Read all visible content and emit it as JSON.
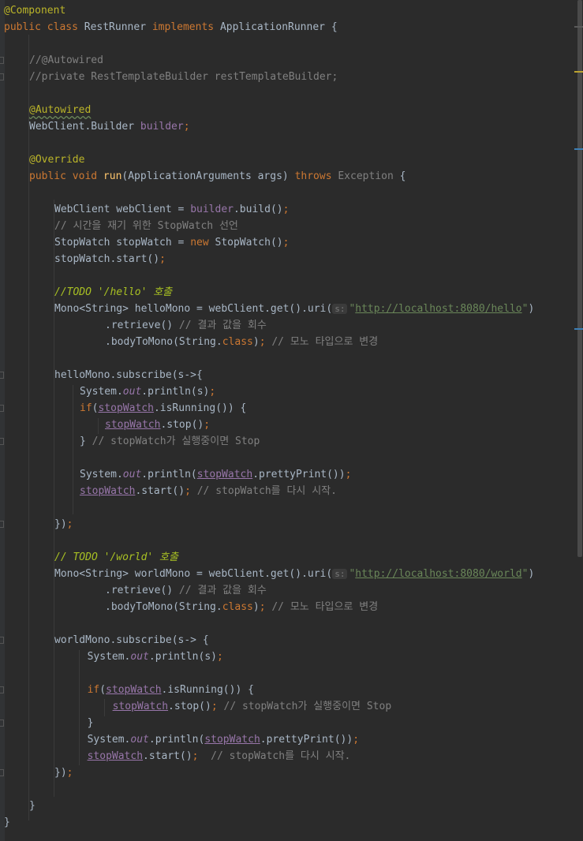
{
  "editor": {
    "language": "java",
    "colors": {
      "background": "#2b2b2b",
      "keyword": "#cc7832",
      "annotation": "#bbb529",
      "comment": "#808080",
      "todo": "#a8c023",
      "string": "#6a8759",
      "field": "#9876aa",
      "function": "#ffc66d",
      "text": "#a9b7c6"
    },
    "lines": [
      {
        "indent": 0,
        "tokens": [
          {
            "t": "@Component",
            "c": "ann"
          }
        ]
      },
      {
        "indent": 0,
        "tokens": [
          {
            "t": "public class ",
            "c": "kw"
          },
          {
            "t": "RestRunner ",
            "c": "plain"
          },
          {
            "t": "implements ",
            "c": "kw"
          },
          {
            "t": "ApplicationRunner {",
            "c": "plain"
          }
        ]
      },
      {
        "indent": 0,
        "tokens": []
      },
      {
        "indent": 1,
        "tokens": [
          {
            "t": "//@Autowired",
            "c": "cmt"
          }
        ]
      },
      {
        "indent": 1,
        "tokens": [
          {
            "t": "//private RestTemplateBuilder restTemplateBuilder;",
            "c": "cmt"
          }
        ]
      },
      {
        "indent": 0,
        "tokens": []
      },
      {
        "indent": 1,
        "tokens": [
          {
            "t": "@Autowired",
            "c": "anns"
          }
        ]
      },
      {
        "indent": 1,
        "tokens": [
          {
            "t": "WebClient.Builder ",
            "c": "plain"
          },
          {
            "t": "builder",
            "c": "fld"
          },
          {
            "t": ";",
            "c": "kw"
          }
        ]
      },
      {
        "indent": 0,
        "tokens": []
      },
      {
        "indent": 1,
        "tokens": [
          {
            "t": "@Override",
            "c": "ann"
          }
        ]
      },
      {
        "indent": 1,
        "tokens": [
          {
            "t": "public void ",
            "c": "kw"
          },
          {
            "t": "run",
            "c": "fn"
          },
          {
            "t": "(ApplicationArguments args) ",
            "c": "plain"
          },
          {
            "t": "throws ",
            "c": "kw"
          },
          {
            "t": "Exception",
            "c": "grey"
          },
          {
            "t": " {",
            "c": "plain"
          }
        ]
      },
      {
        "indent": 0,
        "tokens": []
      },
      {
        "indent": 2,
        "tokens": [
          {
            "t": "WebClient webClient = ",
            "c": "plain"
          },
          {
            "t": "builder",
            "c": "fld"
          },
          {
            "t": ".build()",
            "c": "plain"
          },
          {
            "t": ";",
            "c": "kw"
          }
        ]
      },
      {
        "indent": 2,
        "tokens": [
          {
            "t": "// 시간을 재기 위한 StopWatch 선언",
            "c": "cmt"
          }
        ]
      },
      {
        "indent": 2,
        "tokens": [
          {
            "t": "StopWatch stopWatch = ",
            "c": "plain"
          },
          {
            "t": "new ",
            "c": "kw"
          },
          {
            "t": "StopWatch()",
            "c": "plain"
          },
          {
            "t": ";",
            "c": "kw"
          }
        ]
      },
      {
        "indent": 2,
        "tokens": [
          {
            "t": "stopWatch.start()",
            "c": "plain"
          },
          {
            "t": ";",
            "c": "kw"
          }
        ]
      },
      {
        "indent": 0,
        "tokens": []
      },
      {
        "indent": 2,
        "tokens": [
          {
            "t": "//TODO '/hello' 호출",
            "c": "todo"
          }
        ]
      },
      {
        "indent": 2,
        "tokens": [
          {
            "t": "Mono<String> helloMono = webClient.get().uri(",
            "c": "plain"
          },
          {
            "t": "s:",
            "c": "hint"
          },
          {
            "t": "\"",
            "c": "str"
          },
          {
            "t": "http://localhost:8080/hello",
            "c": "url"
          },
          {
            "t": "\"",
            "c": "str"
          },
          {
            "t": ")",
            "c": "plain"
          }
        ]
      },
      {
        "indent": 4,
        "tokens": [
          {
            "t": ".retrieve() ",
            "c": "plain"
          },
          {
            "t": "// 결과 값을 회수",
            "c": "cmt"
          }
        ]
      },
      {
        "indent": 4,
        "tokens": [
          {
            "t": ".bodyToMono(String.",
            "c": "plain"
          },
          {
            "t": "class",
            "c": "kw"
          },
          {
            "t": ")",
            "c": "plain"
          },
          {
            "t": "; ",
            "c": "kw"
          },
          {
            "t": "// 모노 타입으로 변경",
            "c": "cmt"
          }
        ]
      },
      {
        "indent": 0,
        "tokens": []
      },
      {
        "indent": 2,
        "tokens": [
          {
            "t": "helloMono.subscribe(s->{",
            "c": "plain"
          }
        ]
      },
      {
        "indent": 3,
        "tokens": [
          {
            "t": "System.",
            "c": "plain"
          },
          {
            "t": "out",
            "c": "ifld"
          },
          {
            "t": ".println(s)",
            "c": "plain"
          },
          {
            "t": ";",
            "c": "kw"
          }
        ]
      },
      {
        "indent": 3,
        "tokens": [
          {
            "t": "if",
            "c": "kw"
          },
          {
            "t": "(",
            "c": "plain"
          },
          {
            "t": "stopWatch",
            "c": "var"
          },
          {
            "t": ".isRunning()) {",
            "c": "plain"
          }
        ]
      },
      {
        "indent": 4,
        "tokens": [
          {
            "t": "stopWatch",
            "c": "var"
          },
          {
            "t": ".stop()",
            "c": "plain"
          },
          {
            "t": ";",
            "c": "kw"
          }
        ]
      },
      {
        "indent": 3,
        "tokens": [
          {
            "t": "} ",
            "c": "plain"
          },
          {
            "t": "// stopWatch가 실행중이면 Stop",
            "c": "cmt"
          }
        ]
      },
      {
        "indent": 0,
        "tokens": []
      },
      {
        "indent": 3,
        "tokens": [
          {
            "t": "System.",
            "c": "plain"
          },
          {
            "t": "out",
            "c": "ifld"
          },
          {
            "t": ".println(",
            "c": "plain"
          },
          {
            "t": "stopWatch",
            "c": "var"
          },
          {
            "t": ".prettyPrint())",
            "c": "plain"
          },
          {
            "t": ";",
            "c": "kw"
          }
        ]
      },
      {
        "indent": 3,
        "tokens": [
          {
            "t": "stopWatch",
            "c": "var"
          },
          {
            "t": ".start()",
            "c": "plain"
          },
          {
            "t": "; ",
            "c": "kw"
          },
          {
            "t": "// stopWatch를 다시 시작.",
            "c": "cmt"
          }
        ]
      },
      {
        "indent": 0,
        "tokens": []
      },
      {
        "indent": 2,
        "tokens": [
          {
            "t": "})",
            "c": "plain"
          },
          {
            "t": ";",
            "c": "kw"
          }
        ]
      },
      {
        "indent": 0,
        "tokens": []
      },
      {
        "indent": 2,
        "tokens": [
          {
            "t": "// TODO '/world' 호출",
            "c": "todo"
          }
        ]
      },
      {
        "indent": 2,
        "tokens": [
          {
            "t": "Mono<String> worldMono = webClient.get().uri(",
            "c": "plain"
          },
          {
            "t": "s:",
            "c": "hint"
          },
          {
            "t": "\"",
            "c": "str"
          },
          {
            "t": "http://localhost:8080/world",
            "c": "url"
          },
          {
            "t": "\"",
            "c": "str"
          },
          {
            "t": ")",
            "c": "plain"
          }
        ]
      },
      {
        "indent": 4,
        "tokens": [
          {
            "t": ".retrieve() ",
            "c": "plain"
          },
          {
            "t": "// 결과 값을 회수",
            "c": "cmt"
          }
        ]
      },
      {
        "indent": 4,
        "tokens": [
          {
            "t": ".bodyToMono(String.",
            "c": "plain"
          },
          {
            "t": "class",
            "c": "kw"
          },
          {
            "t": ")",
            "c": "plain"
          },
          {
            "t": "; ",
            "c": "kw"
          },
          {
            "t": "// 모노 타입으로 변경",
            "c": "cmt"
          }
        ]
      },
      {
        "indent": 0,
        "tokens": []
      },
      {
        "indent": 2,
        "tokens": [
          {
            "t": "worldMono.subscribe(s-> {",
            "c": "plain"
          }
        ]
      },
      {
        "indent": 3.3,
        "tokens": [
          {
            "t": "System.",
            "c": "plain"
          },
          {
            "t": "out",
            "c": "ifld"
          },
          {
            "t": ".println(s)",
            "c": "plain"
          },
          {
            "t": ";",
            "c": "kw"
          }
        ]
      },
      {
        "indent": 0,
        "tokens": []
      },
      {
        "indent": 3.3,
        "tokens": [
          {
            "t": "if",
            "c": "kw"
          },
          {
            "t": "(",
            "c": "plain"
          },
          {
            "t": "stopWatch",
            "c": "var"
          },
          {
            "t": ".isRunning()) {",
            "c": "plain"
          }
        ]
      },
      {
        "indent": 4.3,
        "tokens": [
          {
            "t": "stopWatch",
            "c": "var"
          },
          {
            "t": ".stop()",
            "c": "plain"
          },
          {
            "t": "; ",
            "c": "kw"
          },
          {
            "t": "// stopWatch가 실행중이면 Stop",
            "c": "cmt"
          }
        ]
      },
      {
        "indent": 3.3,
        "tokens": [
          {
            "t": "}",
            "c": "plain"
          }
        ]
      },
      {
        "indent": 3.3,
        "tokens": [
          {
            "t": "System.",
            "c": "plain"
          },
          {
            "t": "out",
            "c": "ifld"
          },
          {
            "t": ".println(",
            "c": "plain"
          },
          {
            "t": "stopWatch",
            "c": "var"
          },
          {
            "t": ".prettyPrint())",
            "c": "plain"
          },
          {
            "t": ";",
            "c": "kw"
          }
        ]
      },
      {
        "indent": 3.3,
        "tokens": [
          {
            "t": "stopWatch",
            "c": "var"
          },
          {
            "t": ".start()",
            "c": "plain"
          },
          {
            "t": ";  ",
            "c": "kw"
          },
          {
            "t": "// stopWatch를 다시 시작.",
            "c": "cmt"
          }
        ]
      },
      {
        "indent": 2,
        "tokens": [
          {
            "t": "})",
            "c": "plain"
          },
          {
            "t": ";",
            "c": "kw"
          }
        ]
      },
      {
        "indent": 0,
        "tokens": []
      },
      {
        "indent": 1,
        "tokens": [
          {
            "t": "}",
            "c": "plain"
          }
        ]
      },
      {
        "indent": 0,
        "tokens": [
          {
            "t": "}",
            "c": "plain"
          }
        ]
      }
    ]
  }
}
